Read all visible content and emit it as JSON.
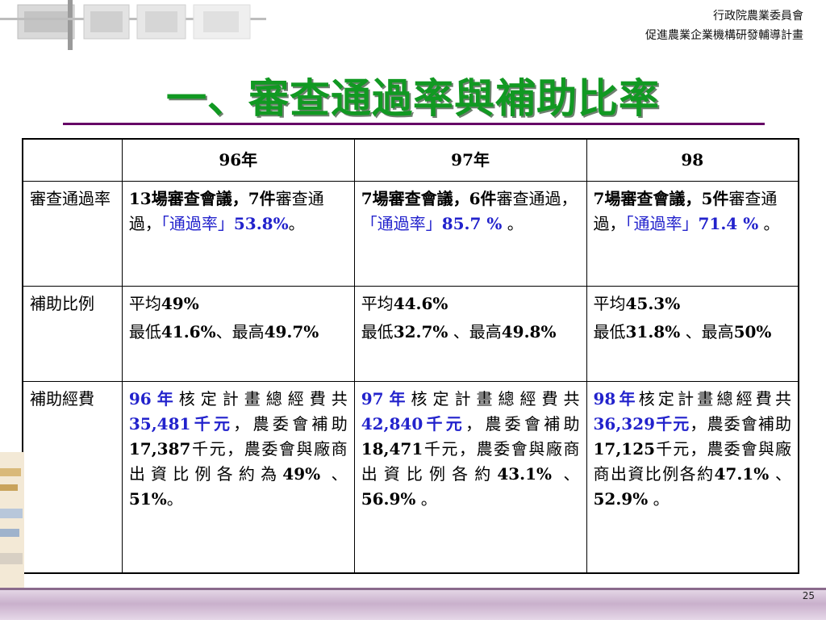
{
  "header": {
    "org_line1": "行政院農業委員會",
    "org_line2": "促進農業企業機構研發輔導計畫"
  },
  "title": "一、審查通過率與補助比率",
  "table": {
    "col_headers": [
      "",
      "96年",
      "97年",
      "98"
    ],
    "rows": [
      {
        "label": "審查通過率",
        "cells": [
          {
            "a": "13場審查會議，",
            "b": "7件",
            "c": "審查通過，",
            "d": "「通過率」",
            "e": "53.8%",
            "f": "。"
          },
          {
            "a": "7場審查會議，",
            "b": "6件",
            "c": "審查通過，",
            "d": "「通過率」",
            "e": "85.7 %",
            "f": " 。"
          },
          {
            "a": "7場審查會議，",
            "b": "5件",
            "c": "審查通過，",
            "d": "「通過率」",
            "e": "71.4 %",
            "f": " 。"
          }
        ]
      },
      {
        "label": "補助比例",
        "cells": [
          {
            "avg_label": "平均",
            "avg_val": "49%",
            "min_label": "最低",
            "min_val": "41.6%",
            "max_label": "、最高",
            "max_val": "49.7%"
          },
          {
            "avg_label": "平均",
            "avg_val": "44.6%",
            "min_label": "最低",
            "min_val": "32.7%",
            "max_label": " 、最高",
            "max_val": "49.8%"
          },
          {
            "avg_label": "平均",
            "avg_val": "45.3%",
            "min_label": "最低",
            "min_val": "31.8%",
            "max_label": " 、最高",
            "max_val": "50%"
          }
        ]
      },
      {
        "label": "補助經費",
        "cells": [
          {
            "year": "96年",
            "t1": "核定計畫總經費共",
            "total": "35,481千元",
            "t2": "，農委會補助",
            "coa": "17,387",
            "t3": "千元，農委會與廠商出資比例各約為",
            "p1": "49%",
            "t4": "  、",
            "p2": "51%",
            "t5": "。"
          },
          {
            "year": "97年",
            "t1": "核定計畫總經費共",
            "total": "42,840千元",
            "t2": "，農委會補助",
            "coa": "18,471",
            "t3": "千元，農委會與廠商出資比例各約",
            "p1": "43.1%",
            "t4": " 、",
            "p2": "56.9%",
            "t5": " 。"
          },
          {
            "year": "98年",
            "t1": "核定計畫總經費共",
            "total": "36,329千元",
            "t2": "，農委會補助",
            "coa": "17,125",
            "t3": "千元，農委會與廠商出資比例各約",
            "p1": "47.1%",
            "t4": " 、",
            "p2": "52.9%",
            "t5": " 。"
          }
        ]
      }
    ]
  },
  "page_number": "25",
  "colors": {
    "title_green": "#119922",
    "accent_blue": "#2222cc",
    "rule_purple": "#660066"
  }
}
